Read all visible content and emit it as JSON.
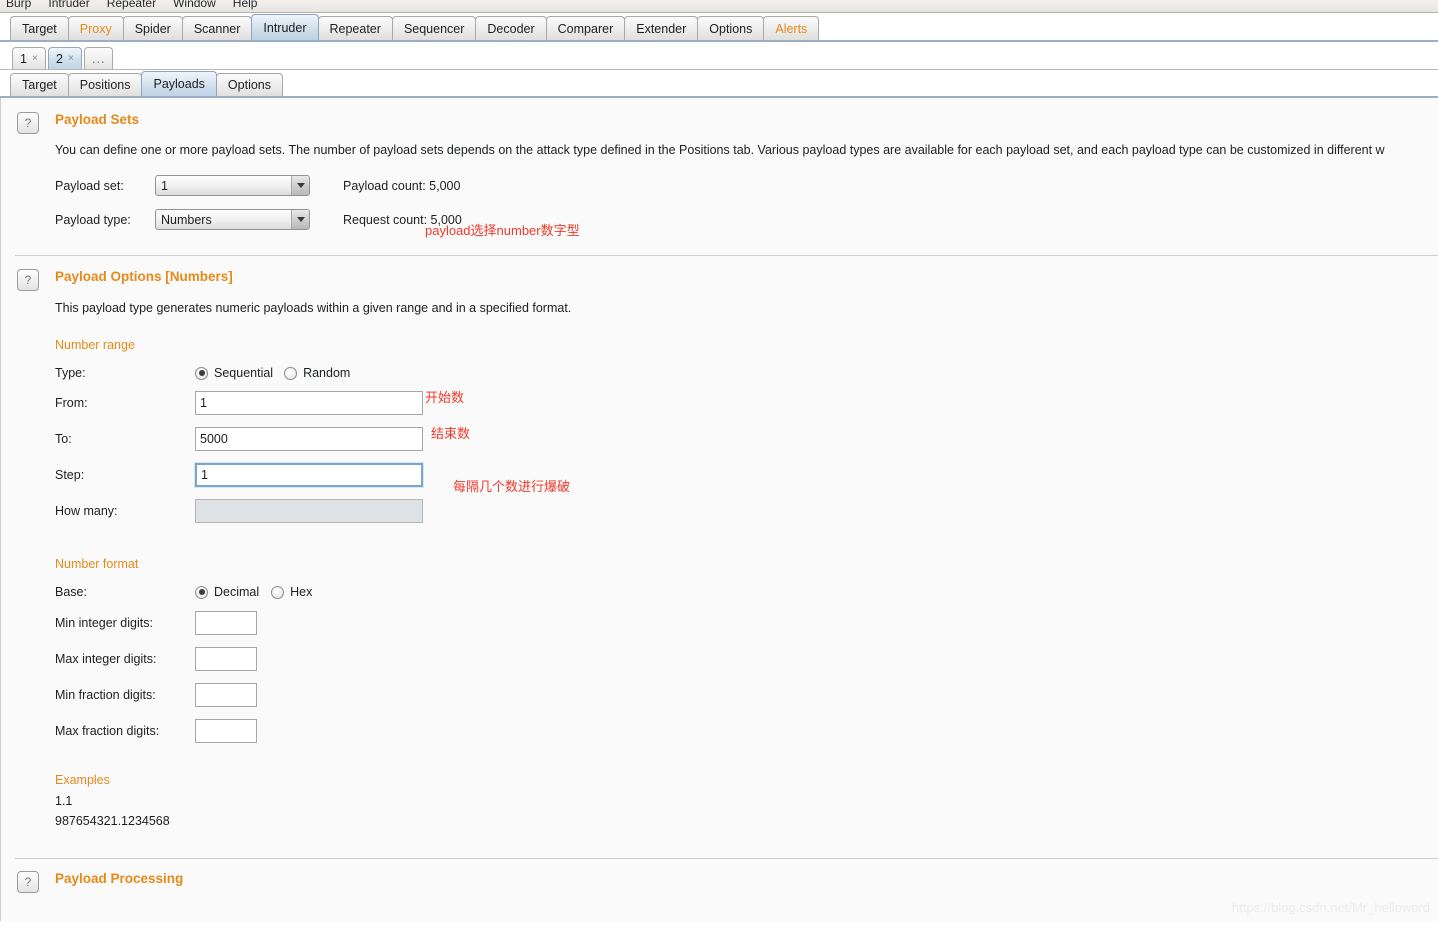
{
  "menu": {
    "items": [
      "Burp",
      "Intruder",
      "Repeater",
      "Window",
      "Help"
    ]
  },
  "main_tabs": [
    {
      "label": "Target",
      "state": "normal"
    },
    {
      "label": "Proxy",
      "state": "alert"
    },
    {
      "label": "Spider",
      "state": "normal"
    },
    {
      "label": "Scanner",
      "state": "normal"
    },
    {
      "label": "Intruder",
      "state": "active"
    },
    {
      "label": "Repeater",
      "state": "normal"
    },
    {
      "label": "Sequencer",
      "state": "normal"
    },
    {
      "label": "Decoder",
      "state": "normal"
    },
    {
      "label": "Comparer",
      "state": "normal"
    },
    {
      "label": "Extender",
      "state": "normal"
    },
    {
      "label": "Options",
      "state": "normal"
    },
    {
      "label": "Alerts",
      "state": "alert"
    }
  ],
  "attack_tabs": [
    {
      "label": "1",
      "close": "×",
      "active": false
    },
    {
      "label": "2",
      "close": "×",
      "active": true
    },
    {
      "label": "...",
      "close": "",
      "active": false
    }
  ],
  "sub_tabs": [
    {
      "label": "Target",
      "active": false
    },
    {
      "label": "Positions",
      "active": false
    },
    {
      "label": "Payloads",
      "active": true
    },
    {
      "label": "Options",
      "active": false
    }
  ],
  "payload_sets": {
    "help": "?",
    "title": "Payload Sets",
    "description": "You can define one or more payload sets. The number of payload sets depends on the attack type defined in the Positions tab. Various payload types are available for each payload set, and each payload type can be customized in different w",
    "payload_set_label": "Payload set:",
    "payload_set_value": "1",
    "payload_type_label": "Payload type:",
    "payload_type_value": "Numbers",
    "payload_count_label": "Payload count:  5,000",
    "request_count_label": "Request count:  5,000",
    "annotation": "payload选择number数字型"
  },
  "payload_options": {
    "help": "?",
    "title": "Payload Options [Numbers]",
    "description": "This payload type generates numeric payloads within a given range and in a specified format.",
    "number_range": {
      "heading": "Number range",
      "type_label": "Type:",
      "type_sequential": "Sequential",
      "type_random": "Random",
      "type_selected": "Sequential",
      "from_label": "From:",
      "from_value": "1",
      "from_annotation": "开始数",
      "to_label": "To:",
      "to_value": "5000",
      "to_annotation": "结束数",
      "step_label": "Step:",
      "step_value": "1",
      "step_annotation": "每隔几个数进行爆破",
      "howmany_label": "How many:",
      "howmany_value": ""
    },
    "number_format": {
      "heading": "Number format",
      "base_label": "Base:",
      "base_decimal": "Decimal",
      "base_hex": "Hex",
      "base_selected": "Decimal",
      "min_int_label": "Min integer digits:",
      "min_int_value": "",
      "max_int_label": "Max integer digits:",
      "max_int_value": "",
      "min_frac_label": "Min fraction digits:",
      "min_frac_value": "",
      "max_frac_label": "Max fraction digits:",
      "max_frac_value": ""
    },
    "examples": {
      "heading": "Examples",
      "lines": [
        "1.1",
        "987654321.1234568"
      ]
    }
  },
  "payload_processing": {
    "help": "?",
    "title": "Payload Processing"
  },
  "watermark": "https://blog.csdn.net/Mr_helloword",
  "colors": {
    "accent_orange": "#e58a1a",
    "annotation_red": "#f0392b",
    "active_tab_blue": "#bed3e5",
    "focus_blue": "#7aa5cc"
  }
}
